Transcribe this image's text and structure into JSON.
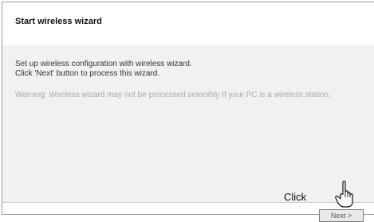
{
  "wizard": {
    "title": "Start wireless wizard",
    "description_line1": "Set up wireless configuration with wireless wizard.",
    "description_line2": "Click 'Next' button to process this wizard.",
    "warning": "Warning: Wireless wizard may not be processed smoothly If your PC is a wireless station."
  },
  "footer": {
    "next_button_label": "Next >",
    "callout_label": "Click"
  },
  "icons": {
    "pointer": "hand-pointer-icon"
  },
  "colors": {
    "content_bg": "#f1f1f1",
    "warning_text": "#a9a9a9"
  }
}
